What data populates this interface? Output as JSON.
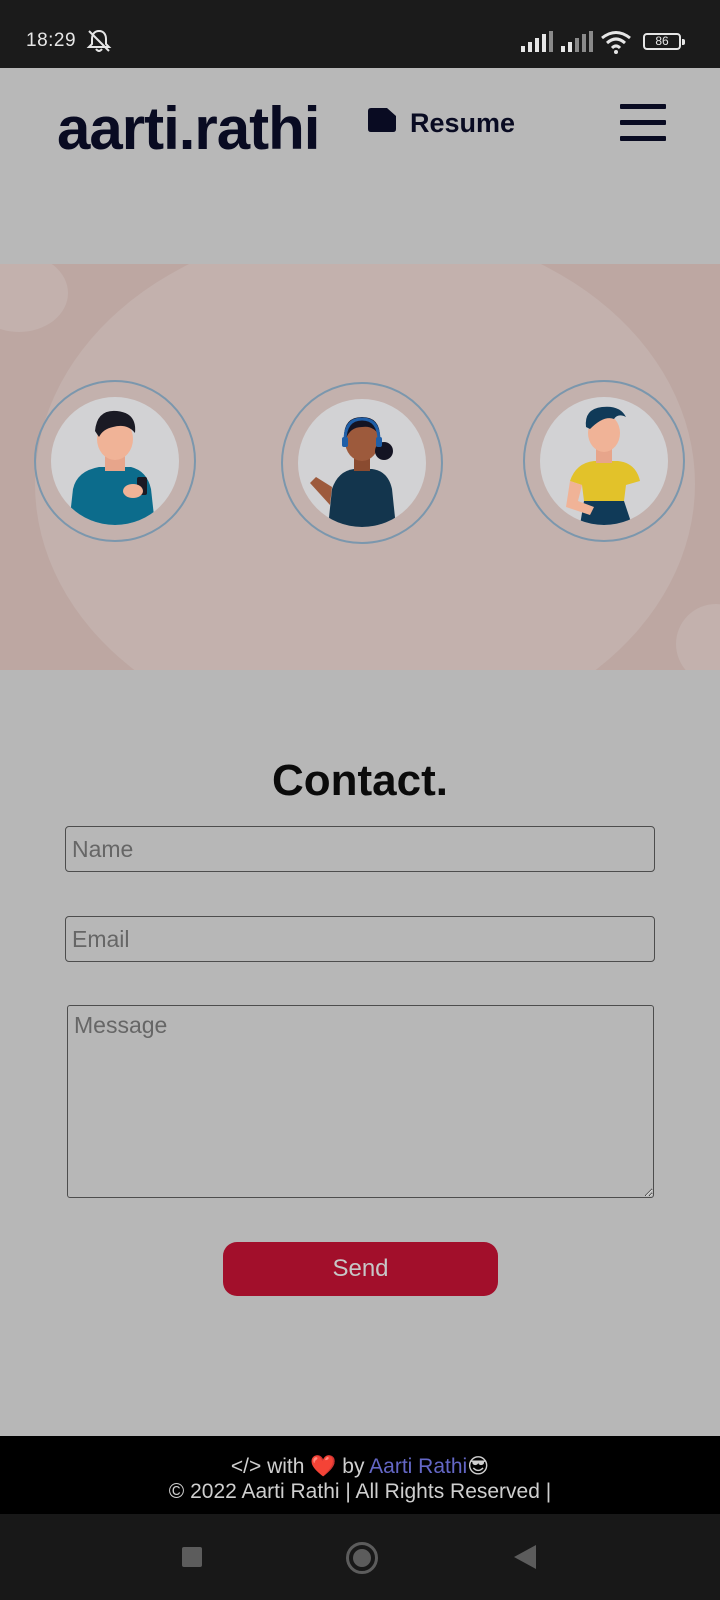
{
  "status_bar": {
    "time": "18:29",
    "battery": "86"
  },
  "navbar": {
    "logo": "aarti.rathi",
    "resume_label": "Resume"
  },
  "contact": {
    "title": "Contact.",
    "name_placeholder": "Name",
    "email_placeholder": "Email",
    "message_placeholder": "Message",
    "send_label": "Send"
  },
  "footer": {
    "line1_prefix": "</> with",
    "heart": "❤️",
    "by": "by",
    "author_link": "Aarti Rathi",
    "emoji": "😎",
    "copyright": "© 2022 Aarti Rathi | All Rights Reserved |"
  },
  "colors": {
    "accent": "#a20f2b",
    "logo_text": "#090b22",
    "link": "#6467c6",
    "hero_bg": "#bda7a2"
  }
}
